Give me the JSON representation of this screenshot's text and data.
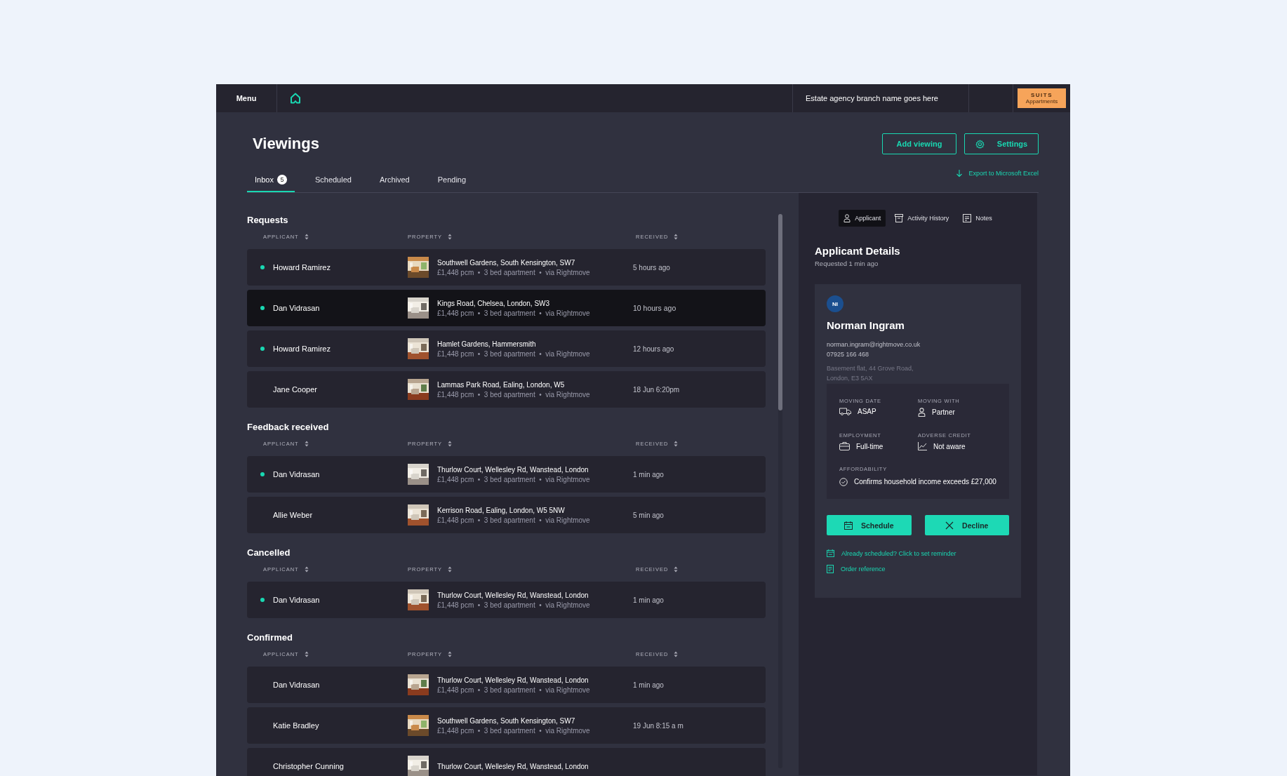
{
  "top_bar": {
    "menu": "Menu",
    "branch": "Estate agency branch name goes here",
    "logo": {
      "line1": "SUITS",
      "line2": "Appartments"
    }
  },
  "page": {
    "title": "Viewings",
    "actions": [
      "Add viewing",
      "Settings"
    ],
    "tabs": [
      {
        "label": "Inbox",
        "badge": "5",
        "selected": true
      },
      {
        "label": "Scheduled",
        "selected": false
      },
      {
        "label": "Archived",
        "selected": false
      },
      {
        "label": "Pending",
        "selected": false
      }
    ],
    "export": "Export to Microsoft Excel"
  },
  "sections": [
    {
      "title": "Requests",
      "columns": [
        "APPLICANT",
        "PROPERTY",
        "RECEIVED"
      ],
      "rows": [
        {
          "applicant": "Howard Ramirez",
          "unread": true,
          "selected": false,
          "address": "Southwell Gardens, South Kensington, SW7",
          "meta": "£1,448 pcm  •  3 bed apartment  •  via Rightmove",
          "received": "5 hours ago"
        },
        {
          "applicant": "Dan Vidrasan",
          "unread": true,
          "selected": true,
          "address": "Kings Road, Chelsea, London, SW3",
          "meta": "£1,448 pcm  •  3 bed apartment  •  via Rightmove",
          "received": "10 hours ago"
        },
        {
          "applicant": "Howard Ramirez",
          "unread": true,
          "selected": false,
          "address": "Hamlet Gardens, Hammersmith",
          "meta": "£1,448 pcm  •  3 bed apartment  •  via Rightmove",
          "received": "12 hours ago"
        },
        {
          "applicant": "Jane Cooper",
          "unread": false,
          "selected": false,
          "address": "Lammas Park Road, Ealing, London, W5",
          "meta": "£1,448 pcm  •  3 bed apartment  •  via Rightmove",
          "received": "18 Jun 6:20pm"
        }
      ]
    },
    {
      "title": "Feedback received",
      "columns": [
        "APPLICANT",
        "PROPERTY",
        "RECEIVED"
      ],
      "rows": [
        {
          "applicant": "Dan Vidrasan",
          "unread": true,
          "selected": false,
          "address": "Thurlow Court, Wellesley Rd, Wanstead, London",
          "meta": "£1,448 pcm  •  3 bed apartment  •  via Rightmove",
          "received": "1 min ago"
        },
        {
          "applicant": "Allie Weber",
          "unread": false,
          "selected": false,
          "address": "Kerrison Road, Ealing, London, W5 5NW",
          "meta": "£1,448 pcm  •  3 bed apartment  •  via Rightmove",
          "received": "5 min ago"
        }
      ]
    },
    {
      "title": "Cancelled",
      "columns": [
        "APPLICANT",
        "PROPERTY",
        "RECEIVED"
      ],
      "rows": [
        {
          "applicant": "Dan Vidrasan",
          "unread": true,
          "selected": false,
          "address": "Thurlow Court, Wellesley Rd, Wanstead, London",
          "meta": "£1,448 pcm  •  3 bed apartment  •  via Rightmove",
          "received": "1 min ago"
        }
      ]
    },
    {
      "title": "Confirmed",
      "columns": [
        "APPLICANT",
        "PROPERTY",
        "RECEIVED"
      ],
      "rows": [
        {
          "applicant": "Dan Vidrasan",
          "unread": false,
          "selected": false,
          "address": "Thurlow Court, Wellesley Rd, Wanstead, London",
          "meta": "£1,448 pcm  •  3 bed apartment  •  via Rightmove",
          "received": "1 min ago"
        },
        {
          "applicant": "Katie Bradley",
          "unread": false,
          "selected": false,
          "address": "Southwell Gardens, South Kensington, SW7",
          "meta": "£1,448 pcm  •  3 bed apartment  •  via Rightmove",
          "received": "19 Jun 8:15 a m"
        },
        {
          "applicant": "Christopher Cunning",
          "unread": false,
          "selected": false,
          "address": "Thurlow Court, Wellesley Rd, Wanstead, London"
        }
      ]
    }
  ],
  "detail": {
    "tabs": [
      {
        "label": "Applicant",
        "selected": true
      },
      {
        "label": "Activity History",
        "selected": false
      },
      {
        "label": "Notes",
        "selected": false
      }
    ],
    "title": "Applicant Details",
    "subtitle": "Requested 1 min ago",
    "initials": "NI",
    "name": "Norman Ingram",
    "email": "norman.ingram@rightmove.co.uk",
    "phone": "07925 166 468",
    "address": [
      "Basement flat, 44 Grove Road,",
      "London, E3 5AX"
    ],
    "facts": [
      {
        "label": "MOVING DATE",
        "value": "ASAP"
      },
      {
        "label": "MOVING WITH",
        "value": "Partner"
      },
      {
        "label": "EMPLOYMENT",
        "value": "Full-time"
      },
      {
        "label": "ADVERSE CREDIT",
        "value": "Not aware"
      }
    ],
    "affordability": {
      "label": "AFFORDABILITY",
      "value": "Confirms household income exceeds £27,000"
    },
    "buttons": [
      "Schedule",
      "Decline"
    ],
    "links": [
      "Already scheduled? Click to set reminder",
      "Order reference"
    ]
  }
}
